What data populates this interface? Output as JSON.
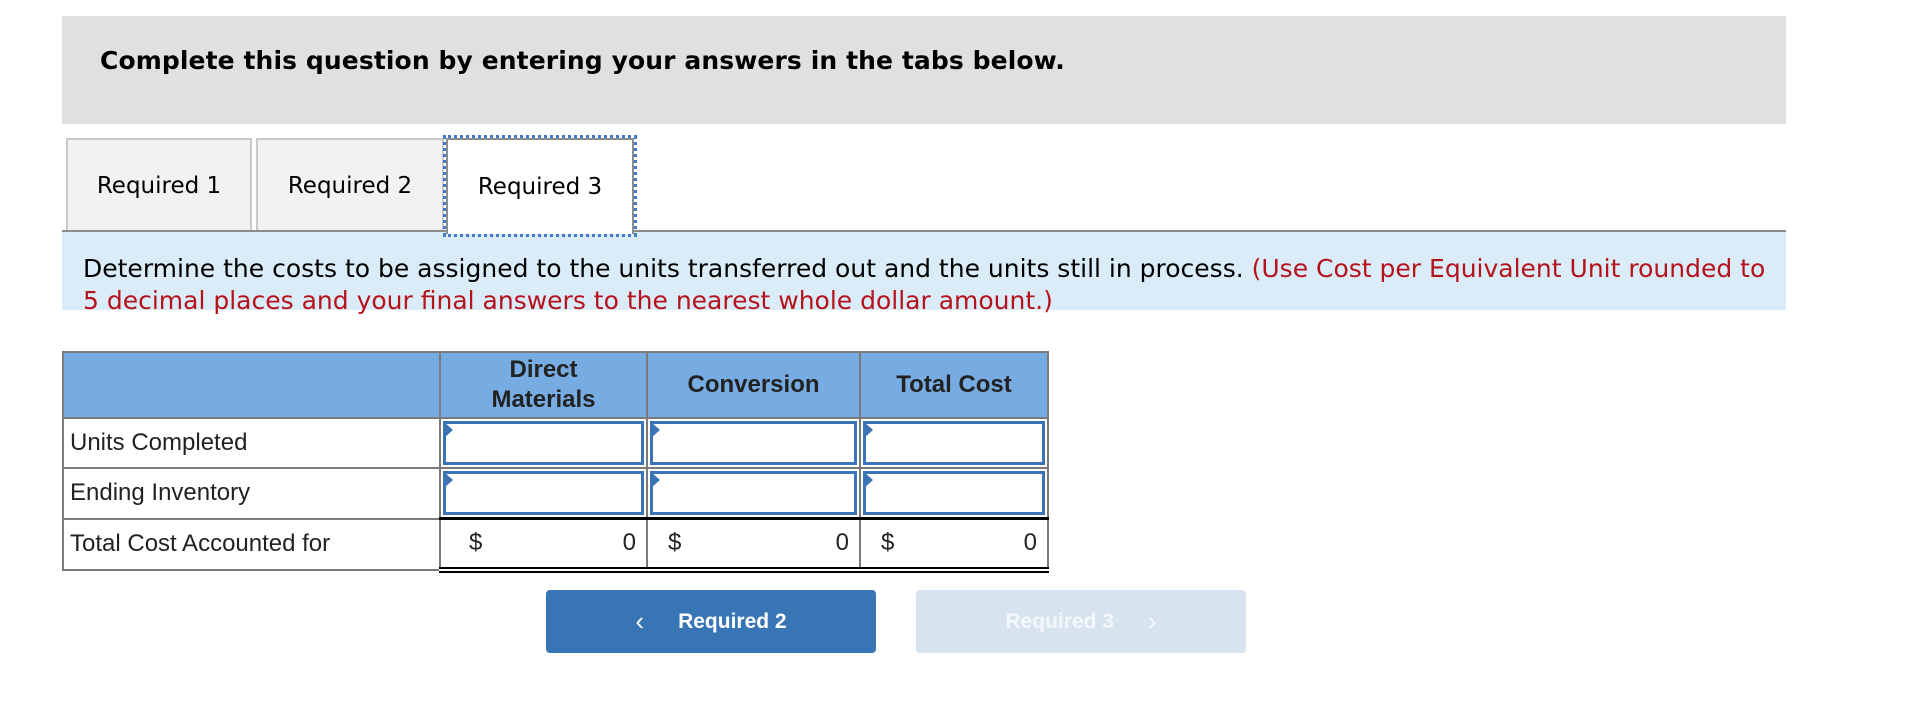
{
  "banner": {
    "title": "Complete this question by entering your answers in the tabs below."
  },
  "tabs": [
    {
      "label": "Required 1",
      "active": false
    },
    {
      "label": "Required 2",
      "active": false
    },
    {
      "label": "Required 3",
      "active": true
    }
  ],
  "instructions": {
    "text": "Determine the costs to be assigned to the units transferred out and the units still in process.",
    "note": "(Use Cost per Equivalent Unit rounded to 5 decimal places and your final answers to the nearest whole dollar amount.)"
  },
  "table": {
    "headers": [
      "",
      "Direct Materials",
      "Conversion",
      "Total Cost"
    ],
    "header_lines": {
      "direct_materials": [
        "Direct",
        "Materials"
      ]
    },
    "rows": [
      {
        "label": "Units Completed",
        "values": [
          "",
          "",
          ""
        ]
      },
      {
        "label": "Ending Inventory",
        "values": [
          "",
          "",
          ""
        ]
      }
    ],
    "total_row": {
      "label": "Total Cost Accounted for",
      "currency_symbol": "$",
      "values": [
        "0",
        "0",
        "0"
      ]
    }
  },
  "navigation": {
    "prev_label": "Required 2",
    "next_label": "Required 3",
    "next_disabled": true,
    "prev_icon": "chevron-left-icon",
    "next_icon": "chevron-right-icon"
  },
  "colors": {
    "banner_bg": "#e0e0e0",
    "instructions_bg": "#dbecf9",
    "note_red": "#b5121b",
    "table_header_bg": "#77ace2",
    "input_border": "#3a74b7",
    "prev_button_bg": "#3875b5",
    "next_button_bg_disabled": "#d8e3f0",
    "active_tab_focus": "#3f7bc6"
  }
}
